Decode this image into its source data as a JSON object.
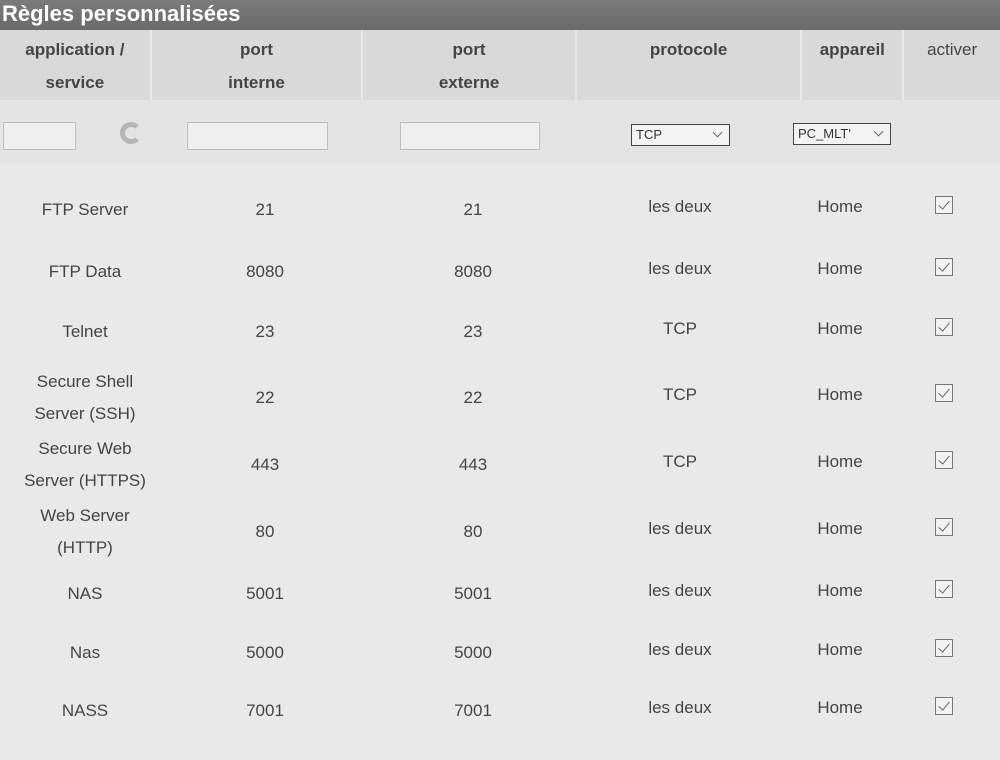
{
  "title": "Règles personnalisées",
  "headers": {
    "app_line1": "application /",
    "app_line2": "service",
    "pin_line1": "port",
    "pin_line2": "interne",
    "pex_line1": "port",
    "pex_line2": "externe",
    "protocol": "protocole",
    "device": "appareil",
    "enable": "activer"
  },
  "input_row": {
    "app_value": "",
    "port_internal_value": "",
    "port_external_value": "",
    "protocol_selected": "TCP",
    "device_selected": "PC_MLT'",
    "refresh_icon": "refresh-icon"
  },
  "rules": [
    {
      "app1": "FTP Server",
      "app2": "",
      "pin": "21",
      "pex": "21",
      "proto": "les deux",
      "device": "Home",
      "enabled": true
    },
    {
      "app1": "FTP Data",
      "app2": "",
      "pin": "8080",
      "pex": "8080",
      "proto": "les deux",
      "device": "Home",
      "enabled": true
    },
    {
      "app1": "Telnet",
      "app2": "",
      "pin": "23",
      "pex": "23",
      "proto": "TCP",
      "device": "Home",
      "enabled": true
    },
    {
      "app1": "Secure Shell",
      "app2": "Server (SSH)",
      "pin": "22",
      "pex": "22",
      "proto": "TCP",
      "device": "Home",
      "enabled": true
    },
    {
      "app1": "Secure Web",
      "app2": "Server (HTTPS)",
      "pin": "443",
      "pex": "443",
      "proto": "TCP",
      "device": "Home",
      "enabled": true
    },
    {
      "app1": "Web Server",
      "app2": "(HTTP)",
      "pin": "80",
      "pex": "80",
      "proto": "les deux",
      "device": "Home",
      "enabled": true
    },
    {
      "app1": "NAS",
      "app2": "",
      "pin": "5001",
      "pex": "5001",
      "proto": "les deux",
      "device": "Home",
      "enabled": true
    },
    {
      "app1": "Nas",
      "app2": "",
      "pin": "5000",
      "pex": "5000",
      "proto": "les deux",
      "device": "Home",
      "enabled": true
    },
    {
      "app1": "NASS",
      "app2": "",
      "pin": "7001",
      "pex": "7001",
      "proto": "les deux",
      "device": "Home",
      "enabled": true
    }
  ]
}
